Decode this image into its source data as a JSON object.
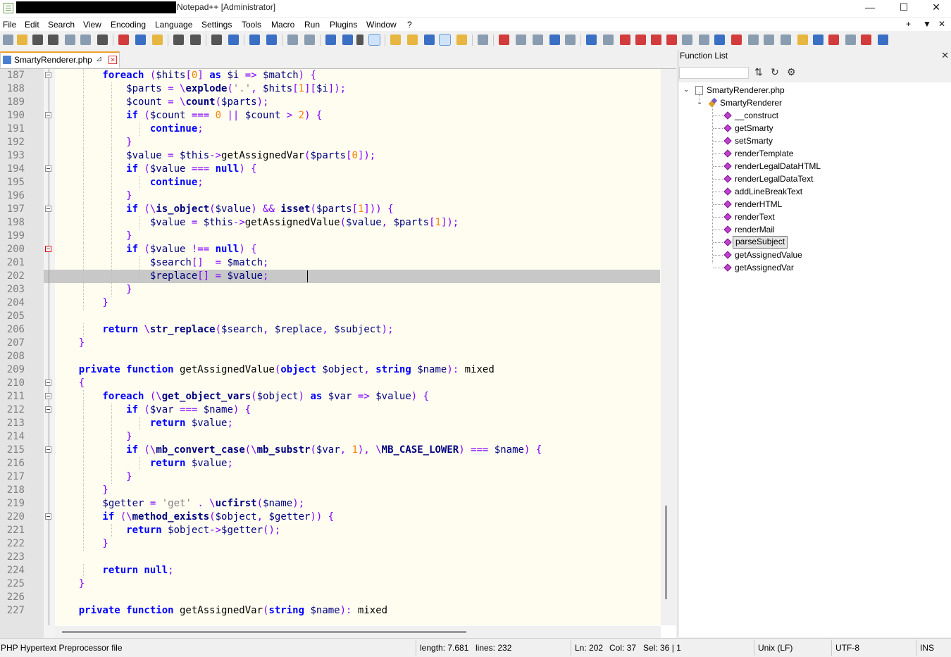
{
  "window": {
    "title": "Notepad++ [Administrator]",
    "controls": {
      "minimize": "—",
      "maximize": "☐",
      "close": "✕"
    }
  },
  "menu": {
    "items": [
      "File",
      "Edit",
      "Search",
      "View",
      "Encoding",
      "Language",
      "Settings",
      "Tools",
      "Macro",
      "Run",
      "Plugins",
      "Window",
      "?"
    ],
    "right": [
      "+",
      "▼",
      "✕"
    ]
  },
  "toolbar": {
    "icons": [
      "new-file",
      "open-file",
      "save",
      "save-all",
      "close",
      "close-all",
      "print",
      "cut",
      "copy",
      "paste",
      "undo",
      "redo",
      "find",
      "replace",
      "zoom-in",
      "zoom-out",
      "sync-vertical",
      "sync-horizontal",
      "word-wrap",
      "show-all-chars",
      "indent-guide",
      "udl",
      "doc-map",
      "doc-list",
      "function-list",
      "folder-as-workspace",
      "monitoring",
      "record-macro",
      "stop-record",
      "play-macro",
      "run-macro-multiple",
      "save-macro",
      "plugin-1",
      "plugin-2",
      "plugin-3",
      "plugin-4",
      "plugin-5",
      "plugin-6",
      "plugin-7",
      "plugin-8",
      "plugin-9",
      "plugin-10",
      "plugin-11",
      "plugin-12",
      "plugin-13",
      "plugin-14",
      "plugin-15",
      "plugin-16",
      "plugin-17",
      "plugin-18",
      "plugin-19"
    ]
  },
  "tab": {
    "label": "SmartyRenderer.php",
    "pin": "⊿",
    "close": "✕"
  },
  "editor": {
    "current_line": 202,
    "lines": [
      {
        "n": "187",
        "fold": true,
        "red": false,
        "t": [
          [
            "kw",
            "        foreach"
          ],
          [
            "op",
            " ("
          ],
          [
            "var",
            "$hits"
          ],
          [
            "op",
            "["
          ],
          [
            "num",
            "0"
          ],
          [
            "op",
            "] "
          ],
          [
            "kw",
            "as"
          ],
          [
            "var",
            " $i"
          ],
          [
            "op",
            " => "
          ],
          [
            "var",
            "$match"
          ],
          [
            "op",
            ") {"
          ]
        ]
      },
      {
        "n": "188",
        "fold": false,
        "red": false,
        "t": [
          [
            "var",
            "            $parts"
          ],
          [
            "op",
            " = \\"
          ],
          [
            "fn",
            "explode"
          ],
          [
            "op",
            "("
          ],
          [
            "str",
            "'.'"
          ],
          [
            "op",
            ", "
          ],
          [
            "var",
            "$hits"
          ],
          [
            "op",
            "["
          ],
          [
            "num",
            "1"
          ],
          [
            "op",
            "]["
          ],
          [
            "var",
            "$i"
          ],
          [
            "op",
            "]);"
          ]
        ]
      },
      {
        "n": "189",
        "fold": false,
        "red": false,
        "t": [
          [
            "var",
            "            $count"
          ],
          [
            "op",
            " = \\"
          ],
          [
            "fn",
            "count"
          ],
          [
            "op",
            "("
          ],
          [
            "var",
            "$parts"
          ],
          [
            "op",
            ");"
          ]
        ]
      },
      {
        "n": "190",
        "fold": true,
        "red": false,
        "t": [
          [
            "kw",
            "            if"
          ],
          [
            "op",
            " ("
          ],
          [
            "var",
            "$count"
          ],
          [
            "op",
            " === "
          ],
          [
            "num",
            "0"
          ],
          [
            "op",
            " || "
          ],
          [
            "var",
            "$count"
          ],
          [
            "op",
            " > "
          ],
          [
            "num",
            "2"
          ],
          [
            "op",
            ") {"
          ]
        ]
      },
      {
        "n": "191",
        "fold": false,
        "red": false,
        "t": [
          [
            "kw",
            "                continue"
          ],
          [
            "op",
            ";"
          ]
        ]
      },
      {
        "n": "192",
        "fold": false,
        "red": false,
        "t": [
          [
            "op",
            "            }"
          ]
        ]
      },
      {
        "n": "193",
        "fold": false,
        "red": false,
        "t": [
          [
            "var",
            "            $value"
          ],
          [
            "op",
            " = "
          ],
          [
            "var",
            "$this"
          ],
          [
            "op",
            "->"
          ],
          [
            "txt",
            "getAssignedVar"
          ],
          [
            "op",
            "("
          ],
          [
            "var",
            "$parts"
          ],
          [
            "op",
            "["
          ],
          [
            "num",
            "0"
          ],
          [
            "op",
            "]);"
          ]
        ]
      },
      {
        "n": "194",
        "fold": true,
        "red": false,
        "t": [
          [
            "kw",
            "            if"
          ],
          [
            "op",
            " ("
          ],
          [
            "var",
            "$value"
          ],
          [
            "op",
            " === "
          ],
          [
            "kw",
            "null"
          ],
          [
            "op",
            ") {"
          ]
        ]
      },
      {
        "n": "195",
        "fold": false,
        "red": false,
        "t": [
          [
            "kw",
            "                continue"
          ],
          [
            "op",
            ";"
          ]
        ]
      },
      {
        "n": "196",
        "fold": false,
        "red": false,
        "t": [
          [
            "op",
            "            }"
          ]
        ]
      },
      {
        "n": "197",
        "fold": true,
        "red": false,
        "t": [
          [
            "kw",
            "            if"
          ],
          [
            "op",
            " (\\"
          ],
          [
            "fn",
            "is_object"
          ],
          [
            "op",
            "("
          ],
          [
            "var",
            "$value"
          ],
          [
            "op",
            ") && "
          ],
          [
            "fn",
            "isset"
          ],
          [
            "op",
            "("
          ],
          [
            "var",
            "$parts"
          ],
          [
            "op",
            "["
          ],
          [
            "num",
            "1"
          ],
          [
            "op",
            "])) {"
          ]
        ]
      },
      {
        "n": "198",
        "fold": false,
        "red": false,
        "t": [
          [
            "var",
            "                $value"
          ],
          [
            "op",
            " = "
          ],
          [
            "var",
            "$this"
          ],
          [
            "op",
            "->"
          ],
          [
            "txt",
            "getAssignedValue"
          ],
          [
            "op",
            "("
          ],
          [
            "var",
            "$value"
          ],
          [
            "op",
            ", "
          ],
          [
            "var",
            "$parts"
          ],
          [
            "op",
            "["
          ],
          [
            "num",
            "1"
          ],
          [
            "op",
            "]);"
          ]
        ]
      },
      {
        "n": "199",
        "fold": false,
        "red": false,
        "t": [
          [
            "op",
            "            }"
          ]
        ]
      },
      {
        "n": "200",
        "fold": true,
        "red": true,
        "t": [
          [
            "kw",
            "            if"
          ],
          [
            "op",
            " ("
          ],
          [
            "var",
            "$value"
          ],
          [
            "op",
            " !== "
          ],
          [
            "kw",
            "null"
          ],
          [
            "op",
            ") {"
          ]
        ]
      },
      {
        "n": "201",
        "fold": false,
        "red": false,
        "t": [
          [
            "var",
            "                $search"
          ],
          [
            "op",
            "[]  = "
          ],
          [
            "var",
            "$match"
          ],
          [
            "op",
            ";"
          ]
        ]
      },
      {
        "n": "202",
        "fold": false,
        "red": false,
        "t": [
          [
            "var",
            "                $replace"
          ],
          [
            "op",
            "[] = "
          ],
          [
            "var",
            "$value"
          ],
          [
            "op",
            ";"
          ]
        ]
      },
      {
        "n": "203",
        "fold": false,
        "red": false,
        "t": [
          [
            "op",
            "            }"
          ]
        ]
      },
      {
        "n": "204",
        "fold": false,
        "red": false,
        "t": [
          [
            "op",
            "        }"
          ]
        ]
      },
      {
        "n": "205",
        "fold": false,
        "red": false,
        "t": []
      },
      {
        "n": "206",
        "fold": false,
        "red": false,
        "t": [
          [
            "kw",
            "        return"
          ],
          [
            "op",
            " \\"
          ],
          [
            "fn",
            "str_replace"
          ],
          [
            "op",
            "("
          ],
          [
            "var",
            "$search"
          ],
          [
            "op",
            ", "
          ],
          [
            "var",
            "$replace"
          ],
          [
            "op",
            ", "
          ],
          [
            "var",
            "$subject"
          ],
          [
            "op",
            ");"
          ]
        ]
      },
      {
        "n": "207",
        "fold": false,
        "red": false,
        "t": [
          [
            "op",
            "    }"
          ]
        ]
      },
      {
        "n": "208",
        "fold": false,
        "red": false,
        "t": []
      },
      {
        "n": "209",
        "fold": false,
        "red": false,
        "t": [
          [
            "kw",
            "    private function"
          ],
          [
            "txt",
            " getAssignedValue"
          ],
          [
            "op",
            "("
          ],
          [
            "kw",
            "object"
          ],
          [
            "var",
            " $object"
          ],
          [
            "op",
            ", "
          ],
          [
            "kw",
            "string"
          ],
          [
            "var",
            " $name"
          ],
          [
            "op",
            "): "
          ],
          [
            "txt",
            "mixed"
          ]
        ]
      },
      {
        "n": "210",
        "fold": true,
        "red": false,
        "t": [
          [
            "op",
            "    {"
          ]
        ]
      },
      {
        "n": "211",
        "fold": true,
        "red": false,
        "t": [
          [
            "kw",
            "        foreach"
          ],
          [
            "op",
            " (\\"
          ],
          [
            "fn",
            "get_object_vars"
          ],
          [
            "op",
            "("
          ],
          [
            "var",
            "$object"
          ],
          [
            "op",
            ") "
          ],
          [
            "kw",
            "as"
          ],
          [
            "var",
            " $var"
          ],
          [
            "op",
            " => "
          ],
          [
            "var",
            "$value"
          ],
          [
            "op",
            ") {"
          ]
        ]
      },
      {
        "n": "212",
        "fold": true,
        "red": false,
        "t": [
          [
            "kw",
            "            if"
          ],
          [
            "op",
            " ("
          ],
          [
            "var",
            "$var"
          ],
          [
            "op",
            " === "
          ],
          [
            "var",
            "$name"
          ],
          [
            "op",
            ") {"
          ]
        ]
      },
      {
        "n": "213",
        "fold": false,
        "red": false,
        "t": [
          [
            "kw",
            "                return"
          ],
          [
            "var",
            " $value"
          ],
          [
            "op",
            ";"
          ]
        ]
      },
      {
        "n": "214",
        "fold": false,
        "red": false,
        "t": [
          [
            "op",
            "            }"
          ]
        ]
      },
      {
        "n": "215",
        "fold": true,
        "red": false,
        "t": [
          [
            "kw",
            "            if"
          ],
          [
            "op",
            " (\\"
          ],
          [
            "fn",
            "mb_convert_case"
          ],
          [
            "op",
            "(\\"
          ],
          [
            "fn",
            "mb_substr"
          ],
          [
            "op",
            "("
          ],
          [
            "var",
            "$var"
          ],
          [
            "op",
            ", "
          ],
          [
            "num",
            "1"
          ],
          [
            "op",
            "), \\"
          ],
          [
            "fn",
            "MB_CASE_LOWER"
          ],
          [
            "op",
            ") === "
          ],
          [
            "var",
            "$name"
          ],
          [
            "op",
            ") {"
          ]
        ]
      },
      {
        "n": "216",
        "fold": false,
        "red": false,
        "t": [
          [
            "kw",
            "                return"
          ],
          [
            "var",
            " $value"
          ],
          [
            "op",
            ";"
          ]
        ]
      },
      {
        "n": "217",
        "fold": false,
        "red": false,
        "t": [
          [
            "op",
            "            }"
          ]
        ]
      },
      {
        "n": "218",
        "fold": false,
        "red": false,
        "t": [
          [
            "op",
            "        }"
          ]
        ]
      },
      {
        "n": "219",
        "fold": false,
        "red": false,
        "t": [
          [
            "var",
            "        $getter"
          ],
          [
            "op",
            " = "
          ],
          [
            "str",
            "'get'"
          ],
          [
            "op",
            " . \\"
          ],
          [
            "fn",
            "ucfirst"
          ],
          [
            "op",
            "("
          ],
          [
            "var",
            "$name"
          ],
          [
            "op",
            ");"
          ]
        ]
      },
      {
        "n": "220",
        "fold": true,
        "red": false,
        "t": [
          [
            "kw",
            "        if"
          ],
          [
            "op",
            " (\\"
          ],
          [
            "fn",
            "method_exists"
          ],
          [
            "op",
            "("
          ],
          [
            "var",
            "$object"
          ],
          [
            "op",
            ", "
          ],
          [
            "var",
            "$getter"
          ],
          [
            "op",
            ")) {"
          ]
        ]
      },
      {
        "n": "221",
        "fold": false,
        "red": false,
        "t": [
          [
            "kw",
            "            return"
          ],
          [
            "var",
            " $object"
          ],
          [
            "op",
            "->"
          ],
          [
            "var",
            "$getter"
          ],
          [
            "op",
            "();"
          ]
        ]
      },
      {
        "n": "222",
        "fold": false,
        "red": false,
        "t": [
          [
            "op",
            "        }"
          ]
        ]
      },
      {
        "n": "223",
        "fold": false,
        "red": false,
        "t": []
      },
      {
        "n": "224",
        "fold": false,
        "red": false,
        "t": [
          [
            "kw",
            "        return null"
          ],
          [
            "op",
            ";"
          ]
        ]
      },
      {
        "n": "225",
        "fold": false,
        "red": false,
        "t": [
          [
            "op",
            "    }"
          ]
        ]
      },
      {
        "n": "226",
        "fold": false,
        "red": false,
        "t": []
      },
      {
        "n": "227",
        "fold": false,
        "red": false,
        "t": [
          [
            "kw",
            "    private function"
          ],
          [
            "txt",
            " getAssignedVar"
          ],
          [
            "op",
            "("
          ],
          [
            "kw",
            "string"
          ],
          [
            "var",
            " $name"
          ],
          [
            "op",
            "): "
          ],
          [
            "txt",
            "mixed"
          ]
        ]
      }
    ]
  },
  "function_list": {
    "title": "Function List",
    "close": "✕",
    "search_placeholder": "",
    "sort_icon": "⇅",
    "reload_icon": "↻",
    "settings_icon": "⚙",
    "file": "SmartyRenderer.php",
    "class": "SmartyRenderer",
    "methods": [
      "__construct",
      "getSmarty",
      "setSmarty",
      "renderTemplate",
      "renderLegalDataHTML",
      "renderLegalDataText",
      "addLineBreakText",
      "renderHTML",
      "renderText",
      "renderMail",
      "parseSubject",
      "getAssignedValue",
      "getAssignedVar"
    ],
    "selected": "parseSubject"
  },
  "status": {
    "filetype": "PHP Hypertext Preprocessor file",
    "length": "length: 7.681",
    "lines": "lines: 232",
    "ln": "Ln: 202",
    "col": "Col: 37",
    "sel": "Sel: 36 | 1",
    "eol": "Unix (LF)",
    "encoding": "UTF-8",
    "mode": "INS"
  }
}
